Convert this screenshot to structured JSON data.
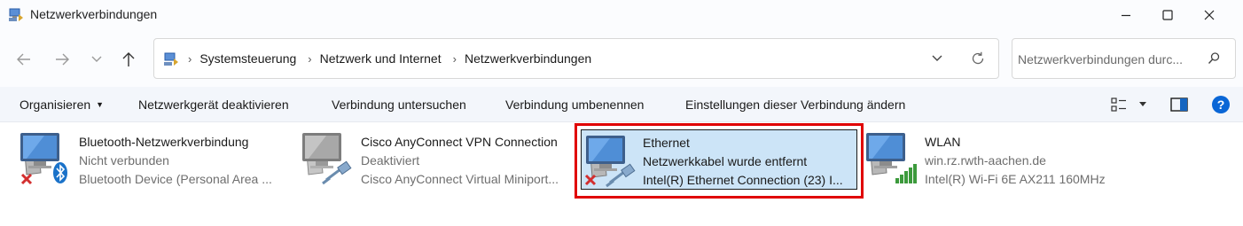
{
  "window": {
    "title": "Netzwerkverbindungen"
  },
  "breadcrumb": {
    "items": [
      "Systemsteuerung",
      "Netzwerk und Internet",
      "Netzwerkverbindungen"
    ]
  },
  "search": {
    "placeholder": "Netzwerkverbindungen durc..."
  },
  "toolbar": {
    "organize_label": "Organisieren",
    "disable_label": "Netzwerkgerät deaktivieren",
    "diagnose_label": "Verbindung untersuchen",
    "rename_label": "Verbindung umbenennen",
    "settings_label": "Einstellungen dieser Verbindung ändern"
  },
  "connections": [
    {
      "name": "Bluetooth-Netzwerkverbindung",
      "status": "Nicht verbunden",
      "device": "Bluetooth Device (Personal Area ...",
      "icon": "monitor-icon",
      "badge": "bluetooth-icon",
      "error": true
    },
    {
      "name": "Cisco AnyConnect VPN Connection",
      "status": "Deaktiviert",
      "device": "Cisco AnyConnect Virtual Miniport...",
      "icon": "monitor-icon",
      "badge": "network-cable-icon",
      "error": false
    },
    {
      "name": "Ethernet",
      "status": "Netzwerkkabel wurde entfernt",
      "device": "Intel(R) Ethernet Connection (23) I...",
      "icon": "monitor-icon",
      "badge": "network-cable-icon",
      "error": true,
      "selected": true
    },
    {
      "name": "WLAN",
      "status": "win.rz.rwth-aachen.de",
      "device": "Intel(R) Wi-Fi 6E AX211 160MHz",
      "icon": "monitor-icon",
      "badge": "wifi-signal-icon",
      "error": false
    }
  ],
  "colors": {
    "selection": "#cce4f7",
    "highlight_frame": "#e00000",
    "error_x": "#d32f2f",
    "help_blue": "#0a66d6",
    "wifi_green": "#3c9a3c"
  }
}
